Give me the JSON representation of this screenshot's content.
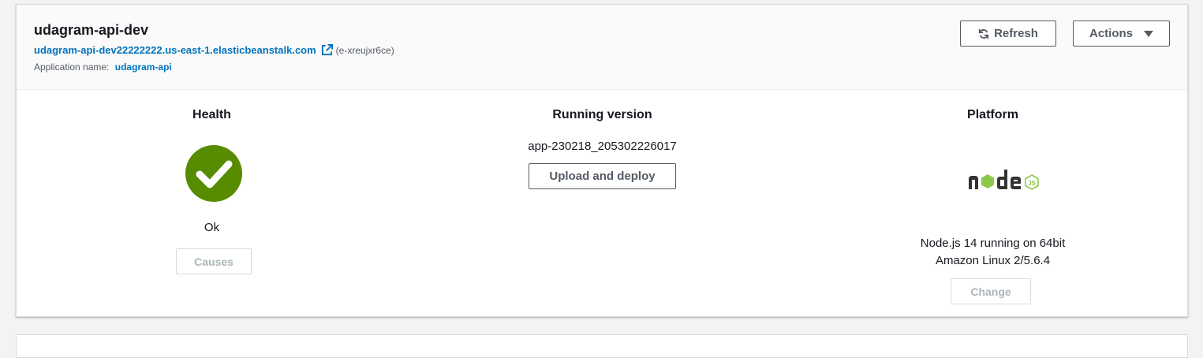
{
  "environment": {
    "name": "udagram-api-dev",
    "url": "udagram-api-dev22222222.us-east-1.elasticbeanstalk.com",
    "env_id": "(e-xreujxr6ce)",
    "application_label": "Application name:",
    "application_name": "udagram-api"
  },
  "header_buttons": {
    "refresh_label": "Refresh",
    "actions_label": "Actions"
  },
  "health": {
    "title": "Health",
    "status": "Ok",
    "status_color": "#578b00",
    "causes_label": "Causes"
  },
  "running_version": {
    "title": "Running version",
    "version": "app-230218_205302226017",
    "upload_label": "Upload and deploy"
  },
  "platform": {
    "title": "Platform",
    "logo_icon": "nodejs-logo-icon",
    "line1": "Node.js 14 running on 64bit",
    "line2": "Amazon Linux 2/5.6.4",
    "change_label": "Change"
  },
  "colors": {
    "link": "#0073bb",
    "node_green": "#8cc84b"
  }
}
